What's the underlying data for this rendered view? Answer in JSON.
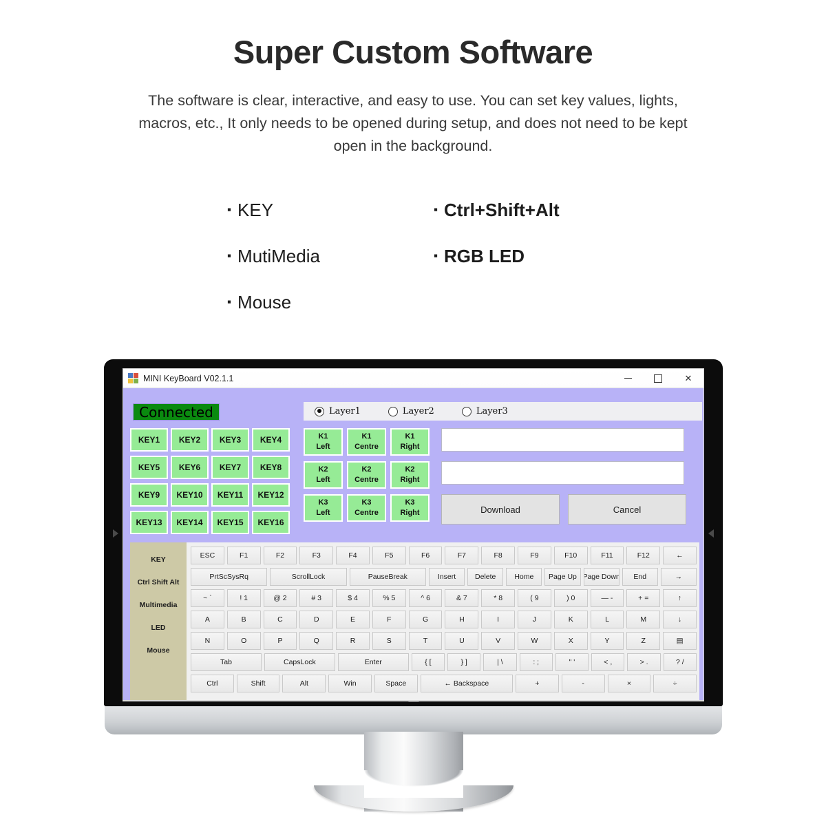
{
  "hero": {
    "title": "Super Custom Software",
    "description": "The software is clear, interactive, and easy to use. You can set key values, lights, macros, etc., It only needs to be opened during setup, and does not need to be kept open in the background.",
    "bullet_glyph": "▪",
    "features_left": [
      "KEY",
      "MutiMedia",
      "Mouse"
    ],
    "features_right": [
      "Ctrl+Shift+Alt",
      "RGB LED"
    ]
  },
  "window": {
    "title": "MINI KeyBoard V02.1.1",
    "icon": "app-tiles-icon",
    "controls": {
      "minimize": "minimize-icon",
      "maximize": "maximize-icon",
      "close": "✕"
    }
  },
  "app": {
    "status": {
      "label": "Connected",
      "color": "#0a8a0f"
    },
    "panel_color": "#b8b2f7",
    "layers": [
      {
        "label": "Layer1",
        "selected": true
      },
      {
        "label": "Layer2",
        "selected": false
      },
      {
        "label": "Layer3",
        "selected": false
      }
    ],
    "macro_keys": [
      "KEY1",
      "KEY2",
      "KEY3",
      "KEY4",
      "KEY5",
      "KEY6",
      "KEY7",
      "KEY8",
      "KEY9",
      "KEY10",
      "KEY11",
      "KEY12",
      "KEY13",
      "KEY14",
      "KEY15",
      "KEY16"
    ],
    "macro_key_color": "#96eb96",
    "knobs": [
      {
        "top": "K1",
        "bottom": "Left"
      },
      {
        "top": "K1",
        "bottom": "Centre"
      },
      {
        "top": "K1",
        "bottom": "Right"
      },
      {
        "top": "K2",
        "bottom": "Left"
      },
      {
        "top": "K2",
        "bottom": "Centre"
      },
      {
        "top": "K2",
        "bottom": "Right"
      },
      {
        "top": "K3",
        "bottom": "Left"
      },
      {
        "top": "K3",
        "bottom": "Centre"
      },
      {
        "top": "K3",
        "bottom": "Right"
      }
    ],
    "inputs": [
      {
        "value": "",
        "placeholder": ""
      },
      {
        "value": "",
        "placeholder": ""
      }
    ],
    "buttons": {
      "download": "Download",
      "cancel": "Cancel"
    },
    "tabs": [
      {
        "label": "KEY",
        "selected": true
      },
      {
        "label": "Ctrl Shift Alt",
        "selected": false
      },
      {
        "label": "Multimedia",
        "selected": false
      },
      {
        "label": "LED",
        "selected": false
      },
      {
        "label": "Mouse",
        "selected": false
      }
    ],
    "tab_strip_color": "#cdc9a6",
    "keyboard_rows": [
      {
        "wide": false,
        "keys": [
          "ESC",
          "F1",
          "F2",
          "F3",
          "F4",
          "F5",
          "F6",
          "F7",
          "F8",
          "F9",
          "F10",
          "F11",
          "F12",
          "←"
        ]
      },
      {
        "wide": false,
        "keys": [
          "PrtScSysRq",
          "ScrollLock",
          "PauseBreak",
          "Insert",
          "Delete",
          "Home",
          "Page Up",
          "Page Down",
          "End",
          "→"
        ]
      },
      {
        "wide": false,
        "keys": [
          "~ `",
          "! 1",
          "@ 2",
          "# 3",
          "$ 4",
          "% 5",
          "^ 6",
          "& 7",
          "* 8",
          "( 9",
          ") 0",
          "— -",
          "+ =",
          "↑"
        ]
      },
      {
        "wide": false,
        "keys": [
          "A",
          "B",
          "C",
          "D",
          "E",
          "F",
          "G",
          "H",
          "I",
          "J",
          "K",
          "L",
          "M",
          "↓"
        ]
      },
      {
        "wide": false,
        "keys": [
          "N",
          "O",
          "P",
          "Q",
          "R",
          "S",
          "T",
          "U",
          "V",
          "W",
          "X",
          "Y",
          "Z",
          "▤"
        ]
      },
      {
        "wide": false,
        "keys": [
          "Tab",
          "CapsLock",
          "Enter",
          "{ [",
          "} ]",
          "| \\",
          ": ;",
          "\" '",
          "< ,",
          "> .",
          "? /"
        ]
      },
      {
        "wide": false,
        "keys": [
          "Ctrl",
          "Shift",
          "Alt",
          "Win",
          "Space",
          "← Backspace",
          "+",
          "-",
          "×",
          "÷"
        ]
      }
    ]
  }
}
